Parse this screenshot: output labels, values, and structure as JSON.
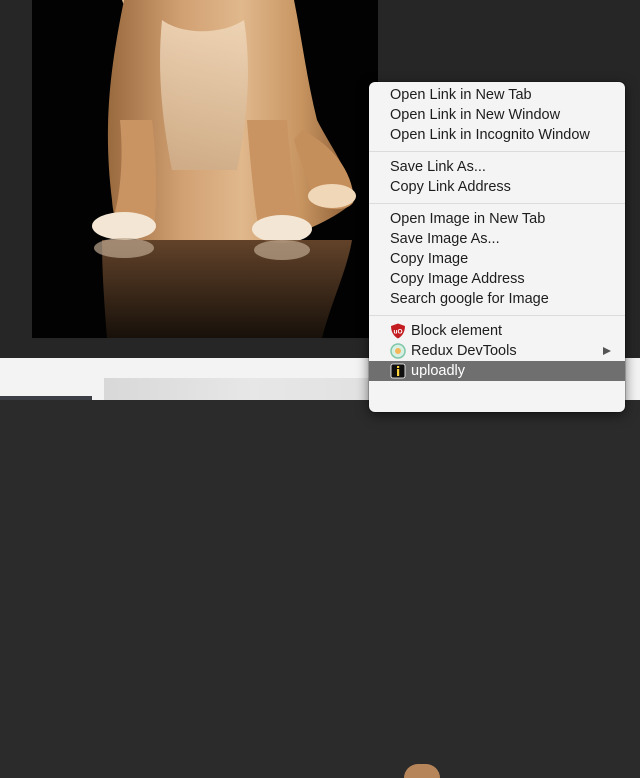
{
  "context_menu": {
    "link_group": [
      {
        "label": "Open Link in New Tab"
      },
      {
        "label": "Open Link in New Window"
      },
      {
        "label": "Open Link in Incognito Window"
      }
    ],
    "save_group": [
      {
        "label": "Save Link As..."
      },
      {
        "label": "Copy Link Address"
      }
    ],
    "image_group": [
      {
        "label": "Open Image in New Tab"
      },
      {
        "label": "Save Image As..."
      },
      {
        "label": "Copy Image"
      },
      {
        "label": "Copy Image Address"
      },
      {
        "label": "Search google for Image"
      }
    ],
    "extension_group": [
      {
        "label": "Block element",
        "icon": "ublock-origin-icon",
        "color": "#c31d22"
      },
      {
        "label": "Redux DevTools",
        "icon": "redux-devtools-icon",
        "has_submenu": true,
        "color": "#7fc7a8"
      },
      {
        "label": "uploadly",
        "icon": "uploadly-icon",
        "highlighted": true,
        "color": "#0f0f0f"
      }
    ]
  },
  "colors": {
    "page_background": "#262626",
    "photo_background": "#020202",
    "menu_background": "#f4f4f4",
    "highlight": "#6f6f6f"
  }
}
